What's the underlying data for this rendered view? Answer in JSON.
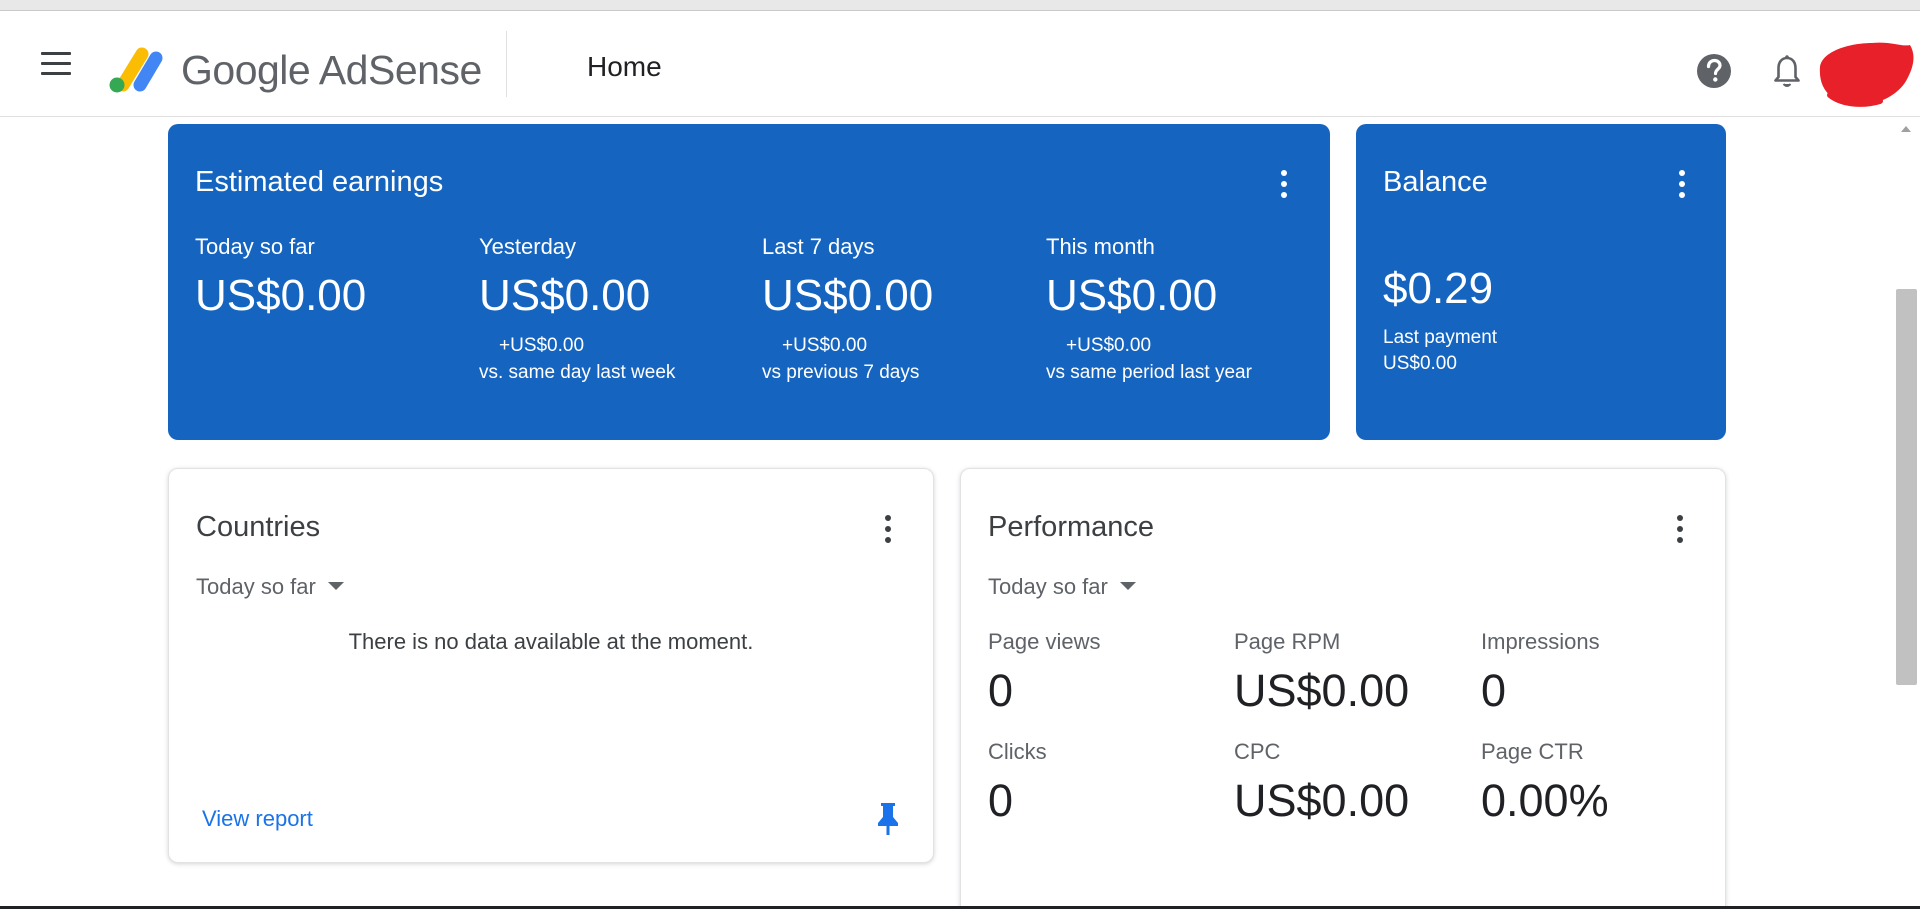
{
  "header": {
    "logo_text": "Google AdSense",
    "page_title": "Home"
  },
  "estimated_earnings": {
    "title": "Estimated earnings",
    "columns": [
      {
        "label": "Today so far",
        "value": "US$0.00",
        "delta": "",
        "compare": ""
      },
      {
        "label": "Yesterday",
        "value": "US$0.00",
        "delta": "+US$0.00",
        "compare": "vs. same day last week"
      },
      {
        "label": "Last 7 days",
        "value": "US$0.00",
        "delta": "+US$0.00",
        "compare": "vs previous 7 days"
      },
      {
        "label": "This month",
        "value": "US$0.00",
        "delta": "+US$0.00",
        "compare": "vs same period last year"
      }
    ]
  },
  "balance": {
    "title": "Balance",
    "value": "$0.29",
    "last_payment_label": "Last payment",
    "last_payment_value": "US$0.00"
  },
  "countries": {
    "title": "Countries",
    "period": "Today so far",
    "empty_message": "There is no data available at the moment.",
    "view_report": "View report"
  },
  "performance": {
    "title": "Performance",
    "period": "Today so far",
    "metrics": [
      {
        "label": "Page views",
        "value": "0"
      },
      {
        "label": "Page RPM",
        "value": "US$0.00"
      },
      {
        "label": "Impressions",
        "value": "0"
      },
      {
        "label": "Clicks",
        "value": "0"
      },
      {
        "label": "CPC",
        "value": "US$0.00"
      },
      {
        "label": "Page CTR",
        "value": "0.00%"
      }
    ]
  },
  "colors": {
    "card_blue": "#1565c0",
    "link_blue": "#1a73e8",
    "logo_yellow": "#fbbc04",
    "logo_blue": "#4285f4",
    "logo_green": "#34a853",
    "avatar_red": "#e8202a"
  },
  "icons": {
    "menu": "hamburger-menu-icon",
    "help": "help-circle-icon",
    "notifications": "bell-icon",
    "more": "more-vert-icon",
    "dropdown": "caret-down-icon",
    "pin": "pin-icon"
  }
}
